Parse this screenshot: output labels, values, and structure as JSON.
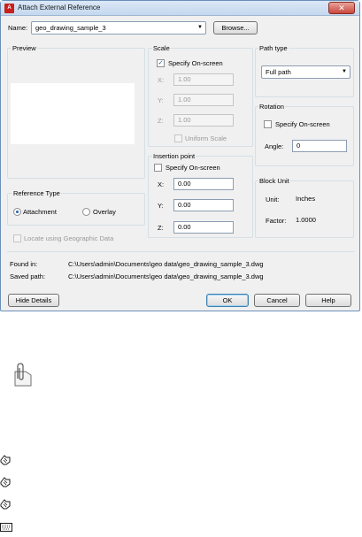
{
  "dialog": {
    "title": "Attach External Reference",
    "title_icon_text": "A",
    "close_symbol": "✕"
  },
  "name_row": {
    "label": "Name:",
    "value": "geo_drawing_sample_3",
    "browse_label": "Browse..."
  },
  "preview": {
    "label": "Preview"
  },
  "scale": {
    "label": "Scale",
    "specify_label": "Specify On-screen",
    "specify_checked": true,
    "x_label": "X:",
    "x_value": "1.00",
    "y_label": "Y:",
    "y_value": "1.00",
    "z_label": "Z:",
    "z_value": "1.00",
    "uniform_label": "Uniform Scale"
  },
  "path_type": {
    "label": "Path type",
    "value": "Full path"
  },
  "rotation": {
    "label": "Rotation",
    "specify_label": "Specify On-screen",
    "angle_label": "Angle:",
    "angle_value": "0"
  },
  "insertion": {
    "label": "Insertion point",
    "specify_label": "Specify On-screen",
    "x_label": "X:",
    "x_value": "0.00",
    "y_label": "Y:",
    "y_value": "0.00",
    "z_label": "Z:",
    "z_value": "0.00"
  },
  "block_unit": {
    "label": "Block Unit",
    "unit_label": "Unit:",
    "unit_value": "Inches",
    "factor_label": "Factor:",
    "factor_value": "1.0000"
  },
  "reference_type": {
    "label": "Reference Type",
    "attachment_label": "Attachment",
    "overlay_label": "Overlay",
    "selected": "Attachment"
  },
  "geo_label": "Locate using Geographic Data",
  "paths": {
    "found_label": "Found in:",
    "found_value": "C:\\Users\\admin\\Documents\\geo data\\geo_drawing_sample_3.dwg",
    "saved_label": "Saved path:",
    "saved_value": "C:\\Users\\admin\\Documents\\geo data\\geo_drawing_sample_3.dwg"
  },
  "buttons": {
    "hide_details": "Hide Details",
    "ok": "OK",
    "cancel": "Cancel",
    "help": "Help"
  },
  "icons": [
    "paperclip-note-icon",
    "pointing-hand-icon",
    "pointing-hand-icon",
    "pointing-hand-icon",
    "keyboard-icon"
  ]
}
